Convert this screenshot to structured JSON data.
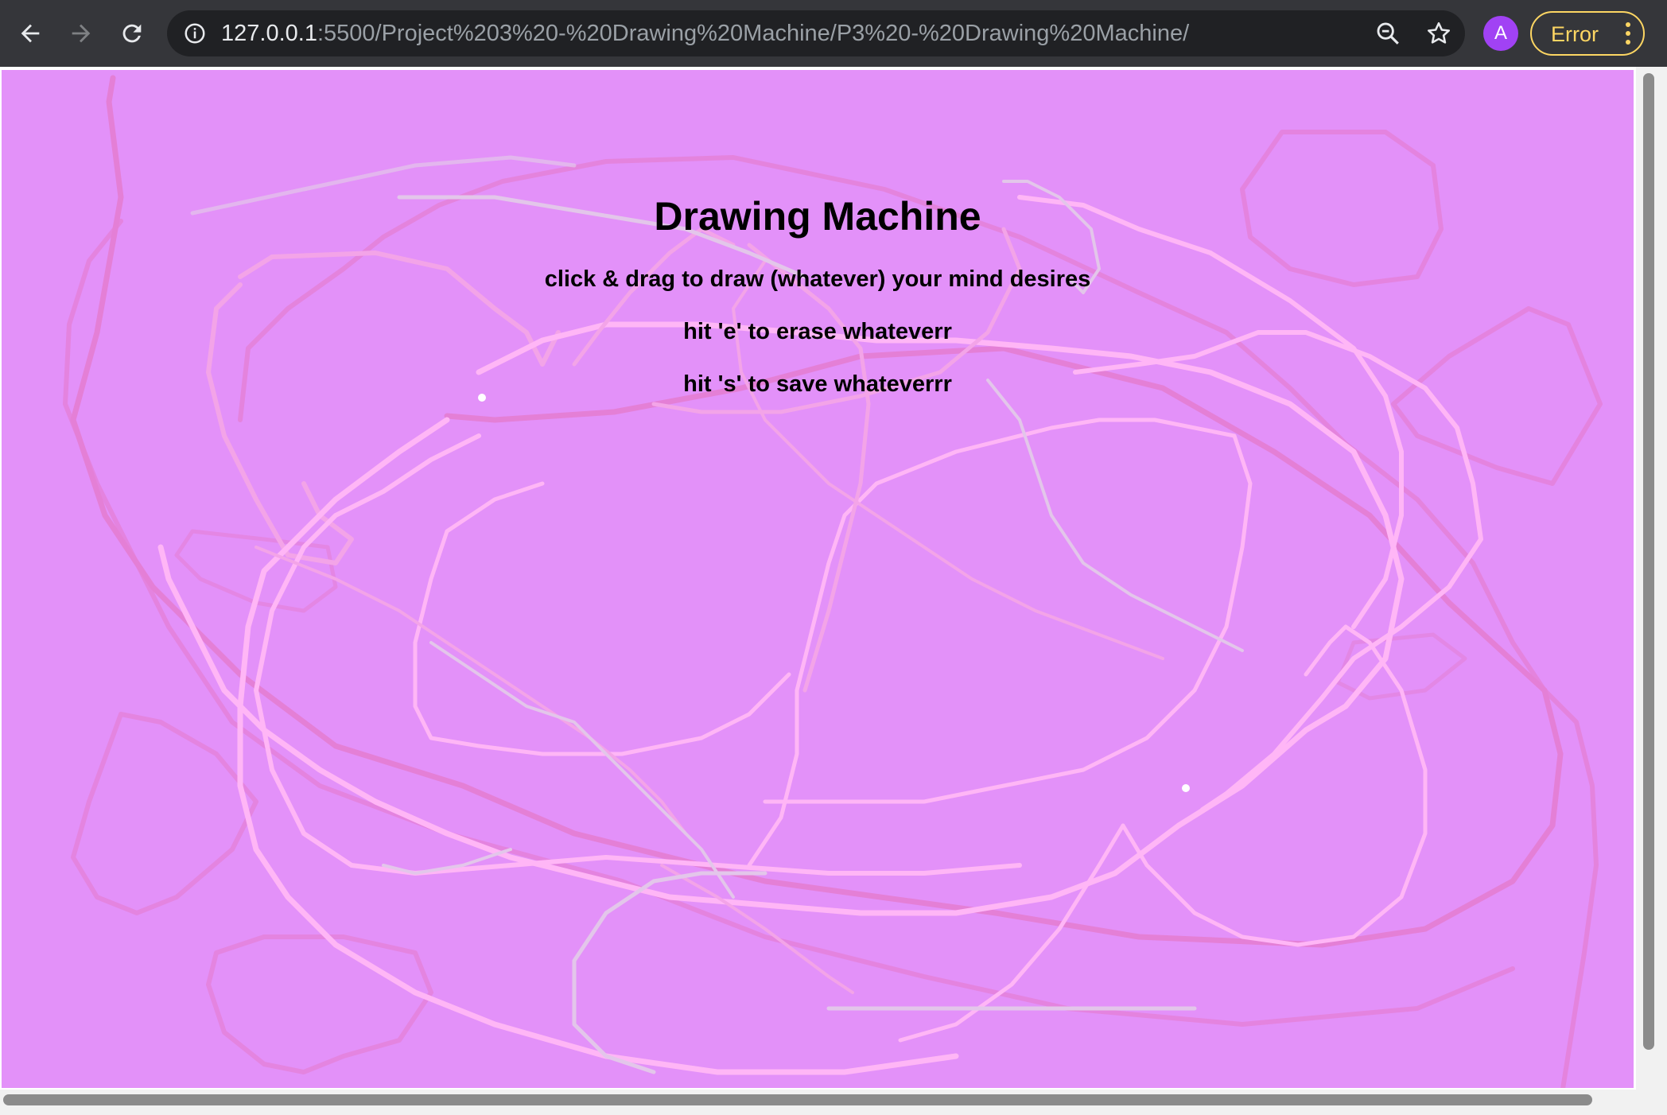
{
  "browser": {
    "url_host": "127.0.0.1",
    "url_rest": ":5500/Project%203%20-%20Drawing%20Machine/P3%20-%20Drawing%20Machine/",
    "avatar_letter": "A",
    "error_label": "Error",
    "icons": {
      "back": "arrow-left-icon",
      "forward": "arrow-right-icon",
      "reload": "reload-icon",
      "info": "info-circle-icon",
      "zoom": "zoom-icon",
      "bookmark": "star-icon",
      "menu": "kebab-menu-icon"
    }
  },
  "page": {
    "background": "#e391f9",
    "title": "Drawing Machine",
    "instructions": [
      "click & drag to draw (whatever) your mind desires",
      "hit 'e' to erase whateverr",
      "hit 's' to save whateverrr"
    ]
  },
  "stroke_colors": {
    "light": "#ffb6f6",
    "mid": "#f3a4e8",
    "grey": "#e3c6ea",
    "dark": "#e47fd6"
  }
}
